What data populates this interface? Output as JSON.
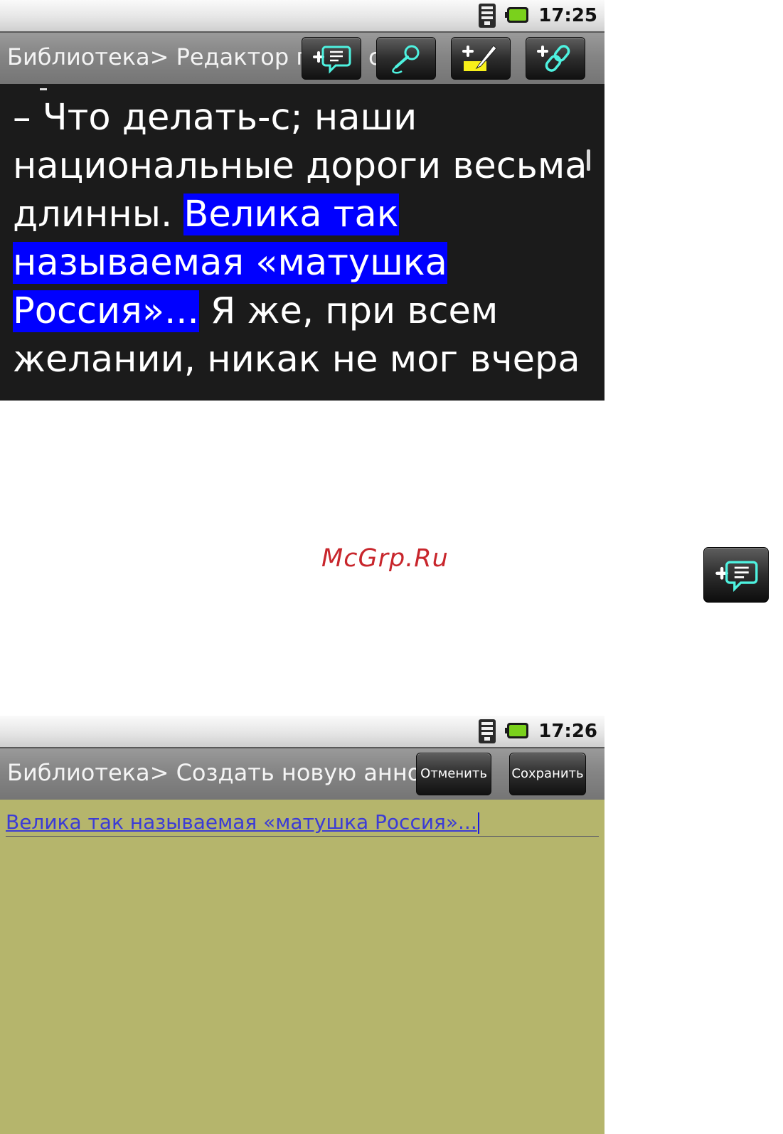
{
  "reader_screen": {
    "status": {
      "time": "17:25"
    },
    "title": "Библиотека> Редактор ги",
    "title_tail": "с",
    "toolbar": {
      "buttons": [
        {
          "icon": "add-note-icon"
        },
        {
          "icon": "add-voice-note-icon"
        },
        {
          "icon": "add-highlight-icon"
        },
        {
          "icon": "add-link-icon"
        }
      ]
    },
    "text_before": "– Что делать-с; наши национальные дороги весьма длинны. ",
    "text_highlight": "Велика так называемая «матушка Россия»...",
    "text_after": " Я же, при всем желании, никак не мог вчера"
  },
  "watermark": "McGrp.Ru",
  "standalone_icon": "add-note-icon",
  "annotation_screen": {
    "status": {
      "time": "17:26"
    },
    "title": "Библиотека> Создать новую аннот",
    "cancel_label": "Отменить",
    "save_label": "Сохранить",
    "input_value": "Велика так называемая «матушка Россия»..."
  },
  "colors": {
    "highlight": "#0000ff",
    "reader_background": "#1b1b1b",
    "annotation_background": "#b5b56c",
    "watermark": "#c8262c"
  }
}
